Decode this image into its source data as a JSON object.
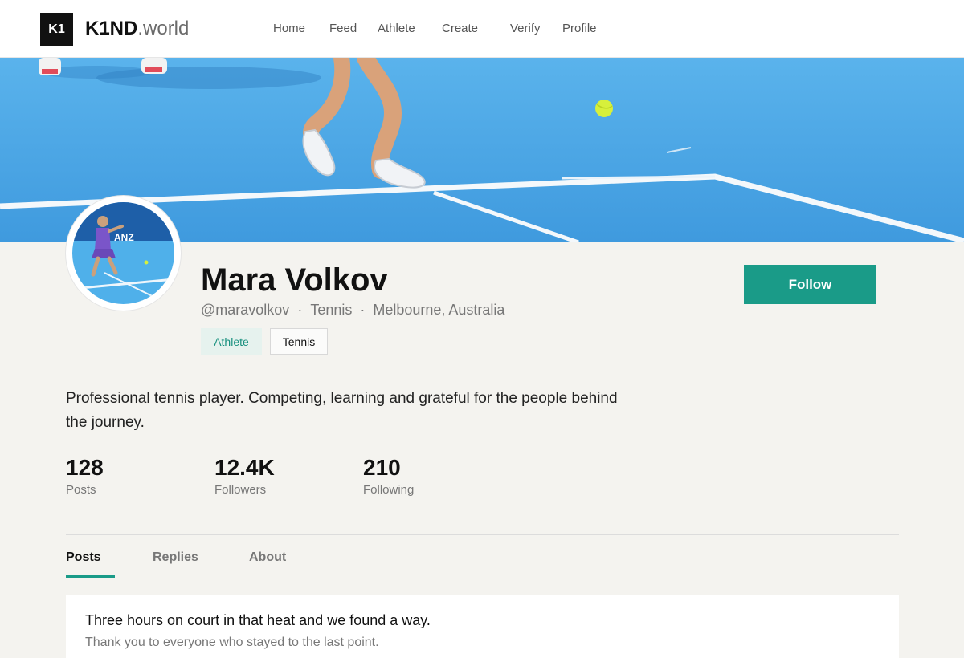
{
  "brand": {
    "logo_mark": "K1",
    "name_bold": "K1ND",
    "name_suffix": ".world"
  },
  "nav": [
    {
      "label": "Home"
    },
    {
      "label": "Feed"
    },
    {
      "label": "Athlete"
    },
    {
      "label": "Create"
    },
    {
      "label": "Verify"
    },
    {
      "label": "Profile"
    }
  ],
  "profile": {
    "name": "Mara Volkov",
    "handle": "@maravolkov",
    "sport": "Tennis",
    "location": "Melbourne, Australia",
    "separator": "·",
    "tags": [
      "Athlete",
      "Tennis"
    ],
    "follow_label": "Follow",
    "bio": "Professional tennis player. Competing, learning and grateful for the people behind the journey.",
    "avatar_sponsor_text": "ANZ"
  },
  "stats": [
    {
      "value": "128",
      "label": "Posts"
    },
    {
      "value": "12.4K",
      "label": "Followers"
    },
    {
      "value": "210",
      "label": "Following"
    }
  ],
  "tabs": [
    {
      "label": "Posts",
      "active": true
    },
    {
      "label": "Replies",
      "active": false
    },
    {
      "label": "About",
      "active": false
    }
  ],
  "post": {
    "title": "Three hours on court in that heat and we found a way.",
    "subtitle": "Thank you to everyone who stayed to the last point."
  },
  "colors": {
    "accent": "#1a9b88",
    "court": "#4aa6e6",
    "background": "#f4f3ef"
  },
  "icons": {
    "banner": "tennis-court-photo",
    "avatar": "athlete-photo"
  }
}
